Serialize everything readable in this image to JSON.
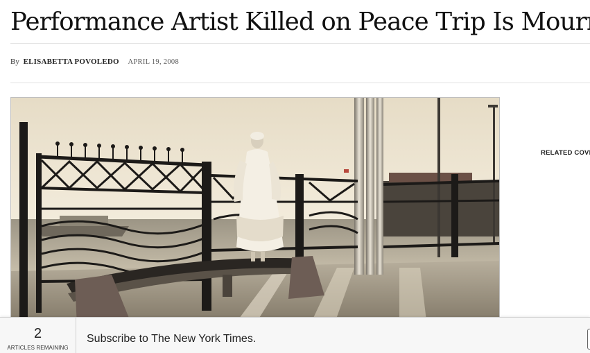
{
  "article": {
    "headline": "Performance Artist Killed on Peace Trip Is Mourned",
    "byline_prefix": "By",
    "author": "ELISABETTA POVOLEDO",
    "date": "APRIL 19, 2008"
  },
  "sidebar": {
    "related_label": "RELATED COVI"
  },
  "meter": {
    "count": "2",
    "label": "ARTICLES REMAINING",
    "subscribe_text": "Subscribe to The New York Times."
  },
  "colors": {
    "sky": "#ece4d2",
    "railing": "#1c1a18",
    "pavement": "#8e8678"
  }
}
